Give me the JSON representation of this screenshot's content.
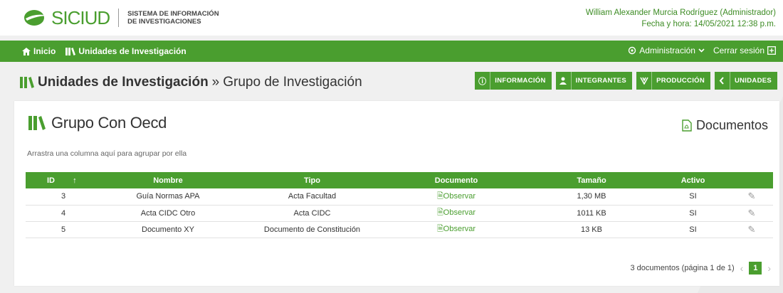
{
  "brand": {
    "logo_text": "SICIUD",
    "subtitle_line1": "SISTEMA DE INFORMACIÓN",
    "subtitle_line2": "DE INVESTIGACIONES"
  },
  "user": {
    "name": "William Alexander Murcia Rodríguez (Administrador)",
    "datetime": "Fecha y hora: 14/05/2021 12:38 p.m."
  },
  "nav": {
    "home": "Inicio",
    "units": "Unidades de Investigación",
    "admin": "Administración",
    "logout": "Cerrar sesión"
  },
  "page": {
    "title_bold": "Unidades de Investigación",
    "title_sep": "»",
    "title_rest": "Grupo de Investigación"
  },
  "actions": {
    "info": "INFORMACIÓN",
    "members": "INTEGRANTES",
    "production": "PRODUCCIÓN",
    "units": "UNIDADES"
  },
  "card": {
    "title": "Grupo Con Oecd",
    "documents_link": "Documentos",
    "group_hint": "Arrastra una columna aquí para agrupar por ella"
  },
  "table": {
    "columns": [
      "ID",
      "Nombre",
      "Tipo",
      "Documento",
      "Tamaño",
      "Activo"
    ],
    "rows": [
      {
        "id": "3",
        "name": "Guía Normas APA",
        "type": "Acta Facultad",
        "doc": "Observar",
        "size": "1,30 MB",
        "active": "SI"
      },
      {
        "id": "4",
        "name": "Acta CIDC Otro",
        "type": "Acta CIDC",
        "doc": "Observar",
        "size": "1011 KB",
        "active": "SI"
      },
      {
        "id": "5",
        "name": "Documento XY",
        "type": "Documento de Constitución",
        "doc": "Observar",
        "size": "13 KB",
        "active": "SI"
      }
    ]
  },
  "pager": {
    "summary": "3 documentos (página 1 de 1)",
    "current": "1"
  },
  "colors": {
    "primary": "#4a9e2f",
    "text": "#333333"
  }
}
